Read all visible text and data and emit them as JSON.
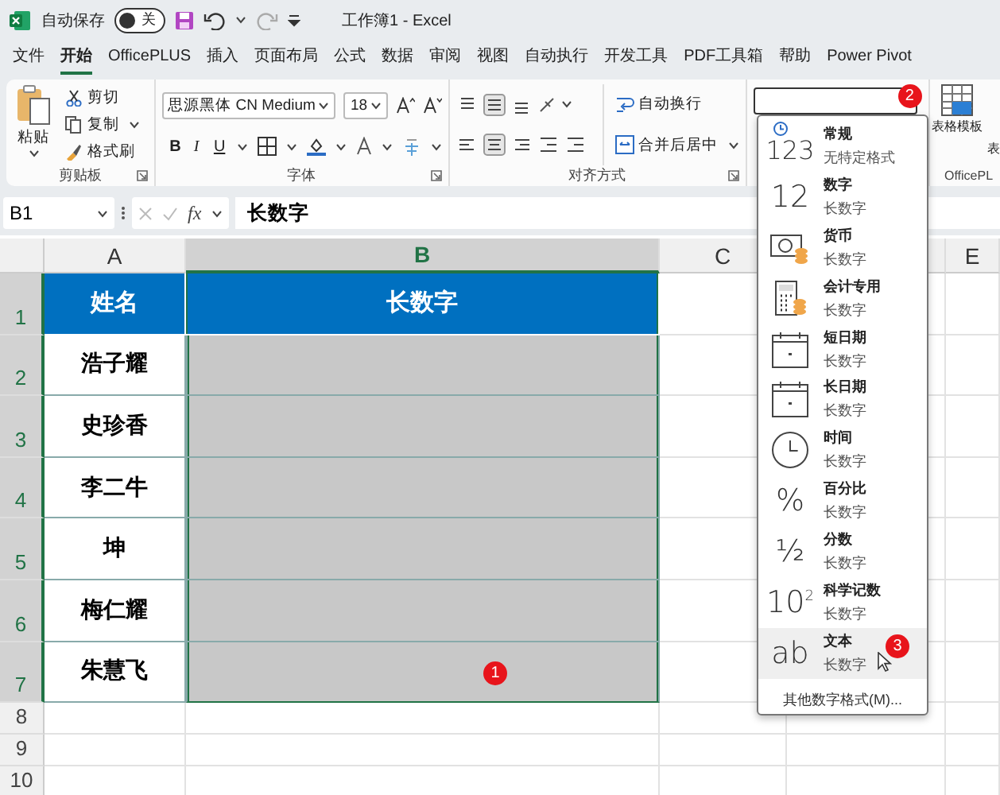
{
  "title_bar": {
    "autosave_label": "自动保存",
    "autosave_toggle": {
      "label": "关",
      "on": false
    },
    "title": "工作簿1  -  Excel"
  },
  "tabs": [
    {
      "label": "文件",
      "selected": false
    },
    {
      "label": "开始",
      "selected": true
    },
    {
      "label": "OfficePLUS",
      "selected": false
    },
    {
      "label": "插入",
      "selected": false
    },
    {
      "label": "页面布局",
      "selected": false
    },
    {
      "label": "公式",
      "selected": false
    },
    {
      "label": "数据",
      "selected": false
    },
    {
      "label": "审阅",
      "selected": false
    },
    {
      "label": "视图",
      "selected": false
    },
    {
      "label": "自动执行",
      "selected": false
    },
    {
      "label": "开发工具",
      "selected": false
    },
    {
      "label": "PDF工具箱",
      "selected": false
    },
    {
      "label": "帮助",
      "selected": false
    },
    {
      "label": "Power Pivot",
      "selected": false
    }
  ],
  "ribbon": {
    "clipboard": {
      "paste": "粘贴",
      "cut": "剪切",
      "copy": "复制",
      "format_painter": "格式刷",
      "label": "剪贴板"
    },
    "font": {
      "font_name": "思源黑体 CN Medium",
      "font_size": "18",
      "bold": "B",
      "italic": "I",
      "underline": "U",
      "label": "字体"
    },
    "alignment": {
      "wrap_text": "自动换行",
      "merge_center": "合并后居中",
      "label": "对齐方式"
    },
    "number_format": {
      "badge": "2"
    },
    "table_template": "表格模板",
    "next_button": "表",
    "officeplus_label": "OfficePL"
  },
  "formula_bar": {
    "name_box": "B1",
    "function_label": "fx",
    "formula": "长数字"
  },
  "sheet": {
    "columns": [
      {
        "label": "A",
        "selected": false
      },
      {
        "label": "B",
        "selected": true
      },
      {
        "label": "C",
        "selected": false
      },
      {
        "selected": false
      },
      {
        "label": "E",
        "selected": false
      }
    ],
    "rows": [
      {
        "number": "1",
        "selected": true,
        "cells": [
          {
            "kind": "header",
            "text": "姓名"
          },
          {
            "kind": "header",
            "text": "长数字"
          }
        ]
      },
      {
        "number": "2",
        "selected": true,
        "cells": [
          {
            "kind": "text",
            "text": "浩子耀"
          },
          {
            "kind": "shaded"
          }
        ]
      },
      {
        "number": "3",
        "selected": true,
        "cells": [
          {
            "kind": "text",
            "text": "史珍香"
          },
          {
            "kind": "shaded"
          }
        ]
      },
      {
        "number": "4",
        "selected": true,
        "cells": [
          {
            "kind": "text",
            "text": "李二牛"
          },
          {
            "kind": "shaded"
          }
        ]
      },
      {
        "number": "5",
        "selected": true,
        "cells": [
          {
            "kind": "text",
            "text": "坤"
          },
          {
            "kind": "shaded"
          }
        ]
      },
      {
        "number": "6",
        "selected": true,
        "cells": [
          {
            "kind": "text",
            "text": "梅仁耀"
          },
          {
            "kind": "shaded"
          }
        ]
      },
      {
        "number": "7",
        "selected": true,
        "cells": [
          {
            "kind": "text",
            "text": "朱慧飞"
          },
          {
            "kind": "shaded",
            "badge": "1"
          }
        ]
      },
      {
        "number": "8",
        "selected": false,
        "cells": []
      },
      {
        "number": "9",
        "selected": false,
        "cells": []
      },
      {
        "number": "10",
        "selected": false,
        "cells": []
      }
    ]
  },
  "number_format_menu": {
    "items": [
      {
        "kind": "general",
        "symbol": "123",
        "title": "常规",
        "subtitle": "无特定格式",
        "selected": false
      },
      {
        "kind": "number",
        "symbol": "12",
        "title": "数字",
        "subtitle": "长数字",
        "selected": false
      },
      {
        "kind": "currency",
        "title": "货币",
        "subtitle": "长数字",
        "selected": false
      },
      {
        "kind": "accounting",
        "title": "会计专用",
        "subtitle": "长数字",
        "selected": false
      },
      {
        "kind": "short_date",
        "title": "短日期",
        "subtitle": "长数字",
        "selected": false
      },
      {
        "kind": "long_date",
        "title": "长日期",
        "subtitle": "长数字",
        "selected": false
      },
      {
        "kind": "time",
        "title": "时间",
        "subtitle": "长数字",
        "selected": false
      },
      {
        "kind": "percent",
        "symbol": "%",
        "title": "百分比",
        "subtitle": "长数字",
        "selected": false
      },
      {
        "kind": "fraction",
        "symbol": "½",
        "title": "分数",
        "subtitle": "长数字",
        "selected": false
      },
      {
        "kind": "scientific",
        "symbol": "10$^{2}$",
        "title": "科学记数",
        "subtitle": "长数字",
        "selected": false
      },
      {
        "kind": "text",
        "symbol": "ab",
        "title": "文本",
        "subtitle": "长数字",
        "selected": true,
        "badge": "3"
      }
    ],
    "more": "其他数字格式(M)..."
  }
}
